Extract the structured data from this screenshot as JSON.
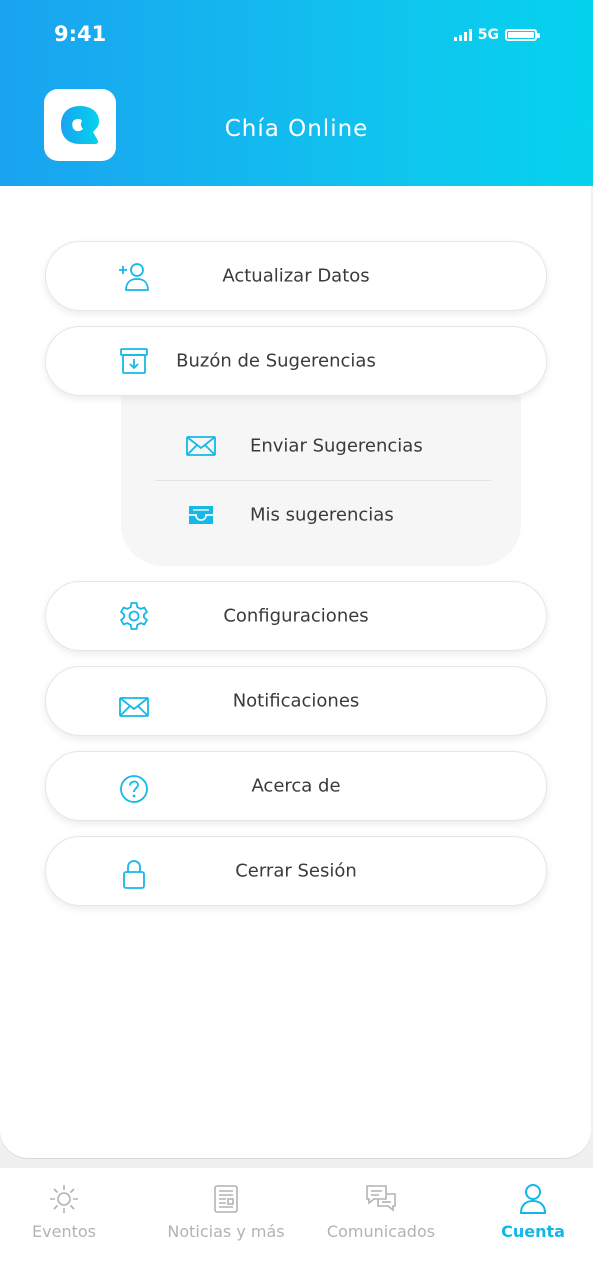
{
  "status_bar": {
    "time": "9:41",
    "network": "5G"
  },
  "header": {
    "title": "Chía Online"
  },
  "menu": {
    "update_data": "Actualizar Datos",
    "suggestions_box": "Buzón de Sugerencias",
    "submenu": {
      "send": "Enviar Sugerencias",
      "mine": "Mis sugerencias"
    },
    "settings": "Configuraciones",
    "notifications": "Notificaciones",
    "about": "Acerca de",
    "logout": "Cerrar Sesión"
  },
  "tabs": [
    {
      "label": "Eventos",
      "icon": "sun-icon",
      "active": false
    },
    {
      "label": "Noticias y más",
      "icon": "newspaper-icon",
      "active": false
    },
    {
      "label": "Comunicados",
      "icon": "chat-bubbles-icon",
      "active": false
    },
    {
      "label": "Cuenta",
      "icon": "user-icon",
      "active": true
    }
  ],
  "colors": {
    "accent": "#12b7e8",
    "header_start": "#1aa3f0",
    "header_end": "#05d3ee",
    "inactive": "#b3b3b3"
  }
}
